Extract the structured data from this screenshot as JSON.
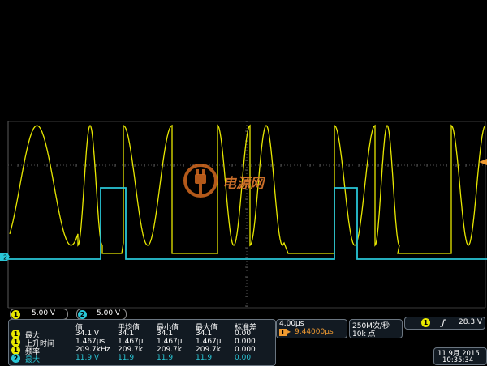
{
  "colors": {
    "ch1": "#e8e800",
    "ch2": "#29c6d6",
    "grid": "#4a4a4a",
    "panel": "#121a22"
  },
  "channels": [
    {
      "id": "1",
      "scale": "5.00 V"
    },
    {
      "id": "2",
      "scale": "5.00 V"
    }
  ],
  "measurements": {
    "headers": [
      "值",
      "平均值",
      "最小值",
      "最大值",
      "标准差"
    ],
    "rows": [
      {
        "ch": "1",
        "name": "最大",
        "value": "34.1 V",
        "mean": "34.1",
        "min": "34.1",
        "max": "34.1",
        "std": "0.00"
      },
      {
        "ch": "1",
        "name": "上升时间",
        "value": "1.467µs",
        "mean": "1.467µ",
        "min": "1.467µ",
        "max": "1.467µ",
        "std": "0.000"
      },
      {
        "ch": "1",
        "name": "频率",
        "value": "209.7kHz",
        "mean": "209.7k",
        "min": "209.7k",
        "max": "209.7k",
        "std": "0.000"
      },
      {
        "ch": "2",
        "name": "最大",
        "value": "11.9 V",
        "mean": "11.9",
        "min": "11.9",
        "max": "11.9",
        "std": "0.00"
      }
    ]
  },
  "timebase": {
    "scale": "4.00µs",
    "delay": "9.44000µs",
    "delay_marker": "T"
  },
  "acquisition": {
    "rate": "250M次/秒",
    "record": "10k 点"
  },
  "trigger": {
    "channel": "1",
    "edge": "rising-edge-icon",
    "level": "28.3 V"
  },
  "datetime": {
    "date": "11 9月 2015",
    "time": "10:35:34"
  },
  "markers": {
    "ch2_ground": "2"
  },
  "watermark": {
    "text": "电源网"
  }
}
